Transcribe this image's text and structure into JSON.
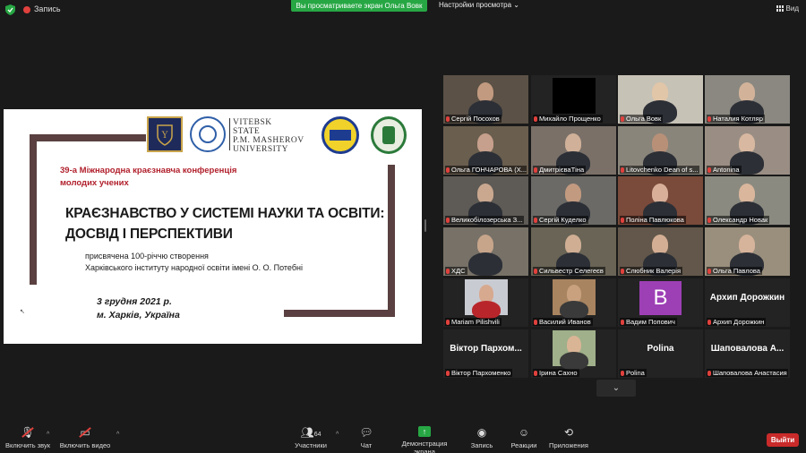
{
  "topbar": {
    "recording_label": "Запись",
    "share_banner": "Вы просматриваете экран Ольга Вовк",
    "view_options": "Настройки просмотра",
    "view_button": "Вид"
  },
  "slide": {
    "logo_text": [
      "VITEBSK",
      "STATE",
      "P.M. MASHEROV",
      "UNIVERSITY"
    ],
    "conference_line1": "39-а Міжнародна краєзнавча конференція",
    "conference_line2": "молодих учених",
    "title_line1": "КРАЄЗНАВСТВО У СИСТЕМІ НАУКИ ТА ОСВІТИ:",
    "title_line2": "ДОСВІД І ПЕРСПЕКТИВИ",
    "subtitle_line1": "присвячена 100-річчю створення",
    "subtitle_line2": "Харківського інституту народної освіти імені О. О. Потебні",
    "date_line1": "3 грудня 2021 р.",
    "date_line2": "м. Харків, Україна"
  },
  "participants": [
    {
      "name": "Сергій Посохов",
      "active": true
    },
    {
      "name": "Михайло Прощенко"
    },
    {
      "name": "Ольга Вовк"
    },
    {
      "name": "Наталия Котляр"
    },
    {
      "name": "Ольга ГОНЧАРОВА (Х..."
    },
    {
      "name": "ДмитрієваТіна"
    },
    {
      "name": "Litovchenko Dean of s..."
    },
    {
      "name": "Antonina"
    },
    {
      "name": "Великобілозерська З..."
    },
    {
      "name": "Сергій Куделко"
    },
    {
      "name": "Поліна Павлюкова"
    },
    {
      "name": "Олександр Новак"
    },
    {
      "name": "ХДС"
    },
    {
      "name": "Сильвестр Селегеєв"
    },
    {
      "name": "Слюбник Валерія"
    },
    {
      "name": "Ольга Павлова"
    },
    {
      "name": "Mariam Pilishvili"
    },
    {
      "name": "Василий Иванов"
    },
    {
      "name": "Вадим Попович",
      "avatar_letter": "B"
    },
    {
      "name": "Архип Дорожкин",
      "display": "Архип Дорожкин"
    },
    {
      "name": "Віктор Пархоменко",
      "display": "Віктор Пархом..."
    },
    {
      "name": "Ірина Сахно"
    },
    {
      "name": "Polina",
      "display": "Polina"
    },
    {
      "name": "Шаповалова Анастасия",
      "display": "Шаповалова А..."
    }
  ],
  "toolbar": {
    "mute": "Включить звук",
    "video": "Включить видео",
    "participants_count": "64",
    "participants": "Участники",
    "chat": "Чат",
    "share_screen": "Демонстрация экрана",
    "record": "Запись",
    "reactions": "Реакции",
    "apps": "Приложения",
    "leave": "Выйти"
  },
  "colors": {
    "accent_green": "#27a744",
    "active_speaker": "#b9e13b",
    "leave_red": "#c92a2a",
    "conference_red": "#b1202c",
    "bracket_brown": "#5a4040"
  }
}
